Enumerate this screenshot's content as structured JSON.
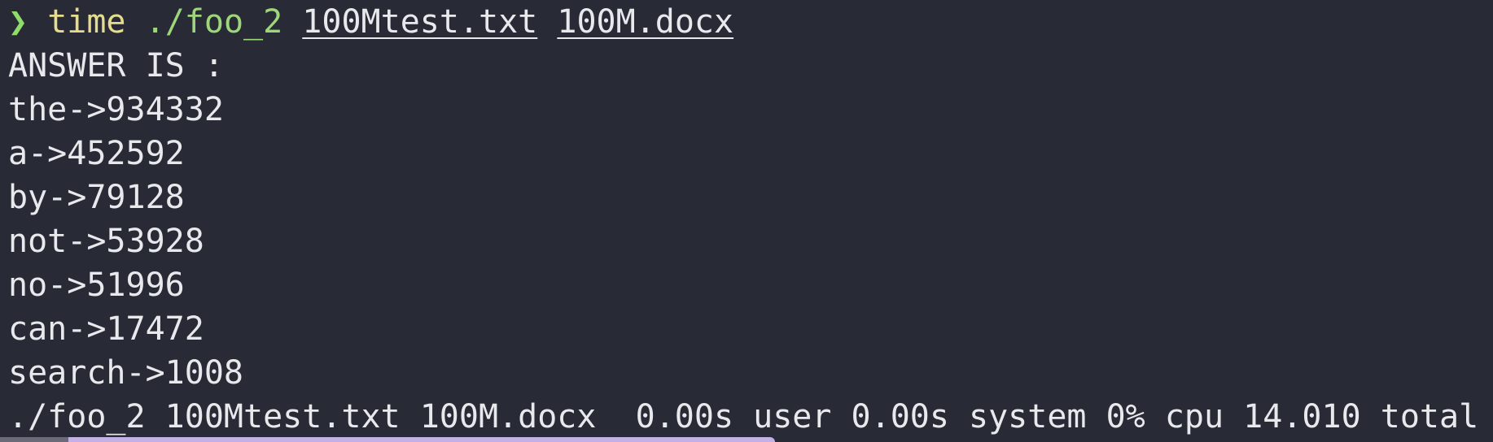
{
  "prompt": {
    "symbol": "❯",
    "command": "time",
    "executable": "./foo_2",
    "arg1": "100Mtest.txt",
    "arg2": "100M.docx"
  },
  "output": {
    "header": "ANSWER IS :",
    "results": [
      "the->934332",
      "a->452592",
      "by->79128",
      "not->53928",
      "no->51996",
      "can->17472",
      "search->1008"
    ],
    "timing": "./foo_2 100Mtest.txt 100M.docx  0.00s user 0.00s system 0% cpu 14.010 total"
  }
}
